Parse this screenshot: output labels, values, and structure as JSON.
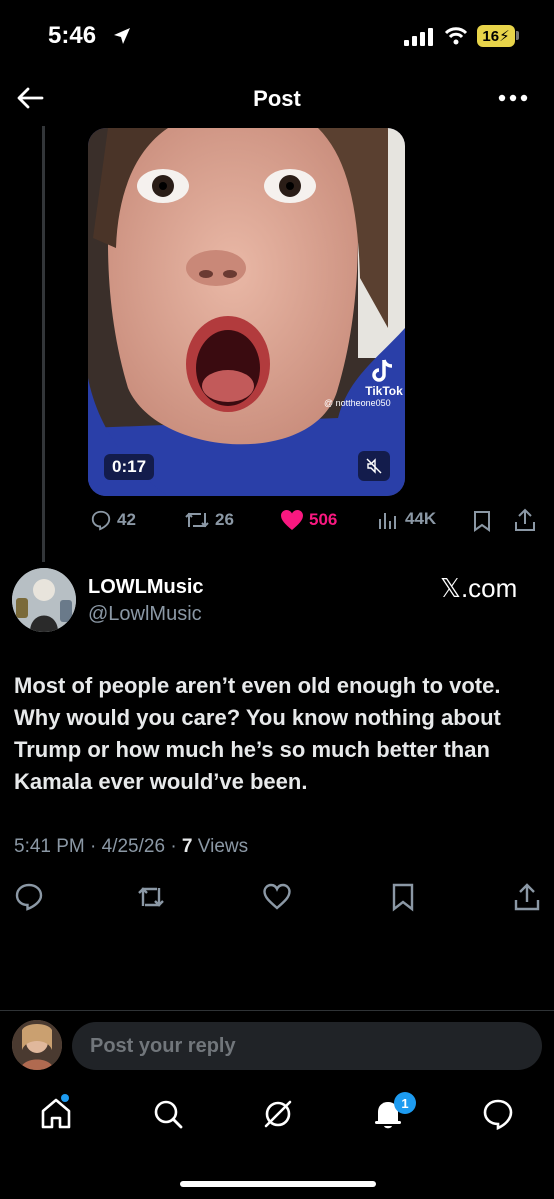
{
  "status": {
    "time": "5:46",
    "battery": "16"
  },
  "header": {
    "title": "Post"
  },
  "quoted": {
    "duration": "0:17",
    "tiktok_label": "TikTok",
    "tiktok_handle": "@ nottheone050",
    "actions": {
      "replies": "42",
      "reposts": "26",
      "likes": "506",
      "views": "44K"
    },
    "colors": {
      "liked": "#f91880"
    }
  },
  "post": {
    "author_name": "LOWLMusic",
    "author_handle": "@LowlMusic",
    "link_domain": "𝕏.com",
    "text": "Most of people aren’t even old enough to vote. Why would you care? You know nothing about Trump or how much he’s so much better than Kamala ever would’ve been.",
    "timestamp": "5:41 PM · 4/25/26 · ",
    "views_count": "7",
    "views_label": " Views"
  },
  "reply": {
    "placeholder": "Post your reply"
  },
  "nav": {
    "notifications_badge": "1"
  },
  "icons": [
    "location-arrow-icon",
    "signal-icon",
    "wifi-icon",
    "back-arrow-icon",
    "more-icon",
    "tiktok-icon",
    "mute-icon",
    "reply-icon",
    "repost-icon",
    "heart-icon",
    "views-icon",
    "bookmark-icon",
    "share-icon",
    "home-icon",
    "search-icon",
    "grok-icon",
    "bell-icon",
    "messages-icon"
  ]
}
